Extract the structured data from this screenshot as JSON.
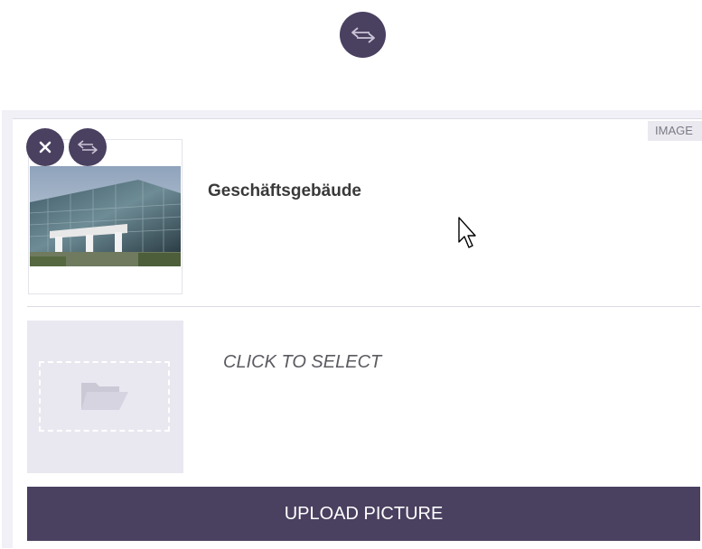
{
  "toolbar": {
    "swap_icon": "swap-arrows-icon"
  },
  "image_item": {
    "tag": "IMAGE",
    "title": "Geschäftsgebäude",
    "remove_icon": "close-icon",
    "swap_icon": "swap-arrows-icon"
  },
  "select_item": {
    "icon": "folder-open-icon",
    "label": "CLICK TO SELECT"
  },
  "upload": {
    "label": "UPLOAD PICTURE"
  },
  "colors": {
    "primary": "#4a4060",
    "panel_bg": "#f1f0f7",
    "dropzone_bg": "#e9e8f1"
  }
}
